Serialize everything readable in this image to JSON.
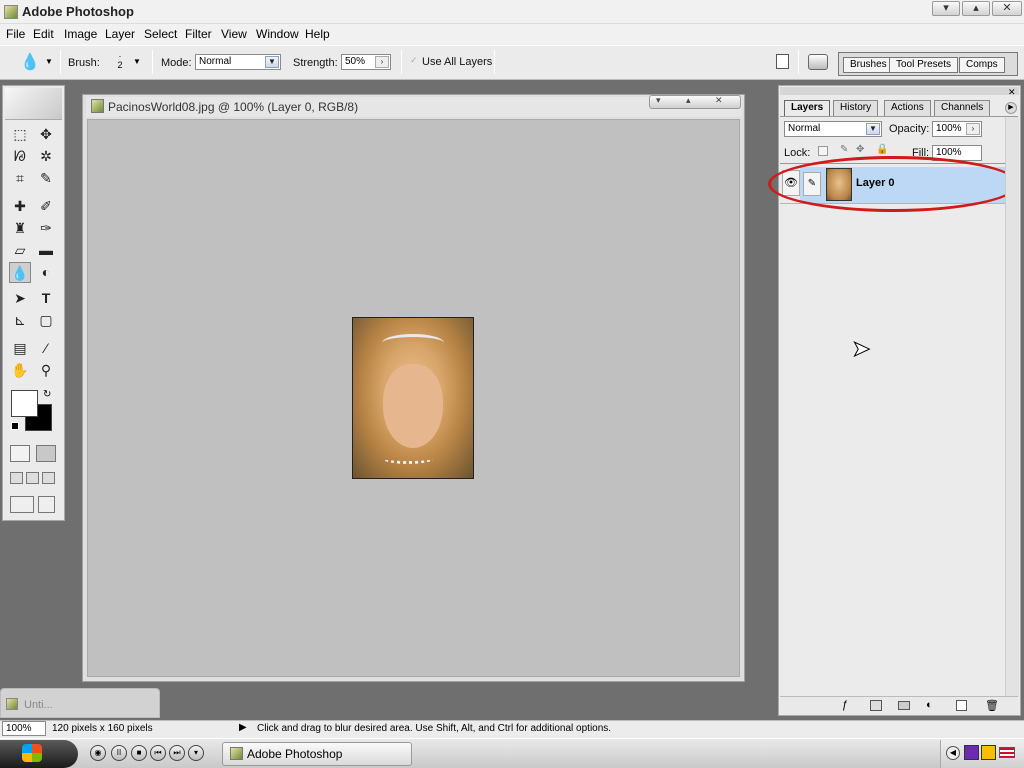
{
  "app": {
    "title": "Adobe Photoshop"
  },
  "window_controls": {
    "minimize": "▾",
    "restore": "▴",
    "close": "✕"
  },
  "menu": [
    "File",
    "Edit",
    "Image",
    "Layer",
    "Select",
    "Filter",
    "View",
    "Window",
    "Help"
  ],
  "options": {
    "brush_label": "Brush:",
    "brush_size": "2",
    "mode_label": "Mode:",
    "mode_value": "Normal",
    "strength_label": "Strength:",
    "strength_value": "50%",
    "use_all_layers": "Use All Layers",
    "panel_well_tabs": [
      "Brushes",
      "Tool Presets",
      "Comps"
    ]
  },
  "document": {
    "title": "PacinosWorld08.jpg @ 100% (Layer 0, RGB/8)",
    "minimized_title": "Unti..."
  },
  "layers_panel": {
    "tabs": [
      "Layers",
      "History",
      "Actions",
      "Channels"
    ],
    "blend_mode": "Normal",
    "opacity_label": "Opacity:",
    "opacity_value": "100%",
    "lock_label": "Lock:",
    "fill_label": "Fill:",
    "fill_value": "100%",
    "layers": [
      {
        "name": "Layer 0",
        "visible": true,
        "selected": true
      }
    ]
  },
  "status": {
    "zoom": "100%",
    "doc_info": "120 pixels x 160 pixels",
    "hint": "Click and drag to blur desired area.  Use Shift, Alt, and Ctrl for additional options."
  },
  "taskbar": {
    "app_button": "Adobe Photoshop"
  },
  "colors": {
    "selection_highlight": "#bcd8f4",
    "annotation_ellipse": "#d11a1a"
  }
}
